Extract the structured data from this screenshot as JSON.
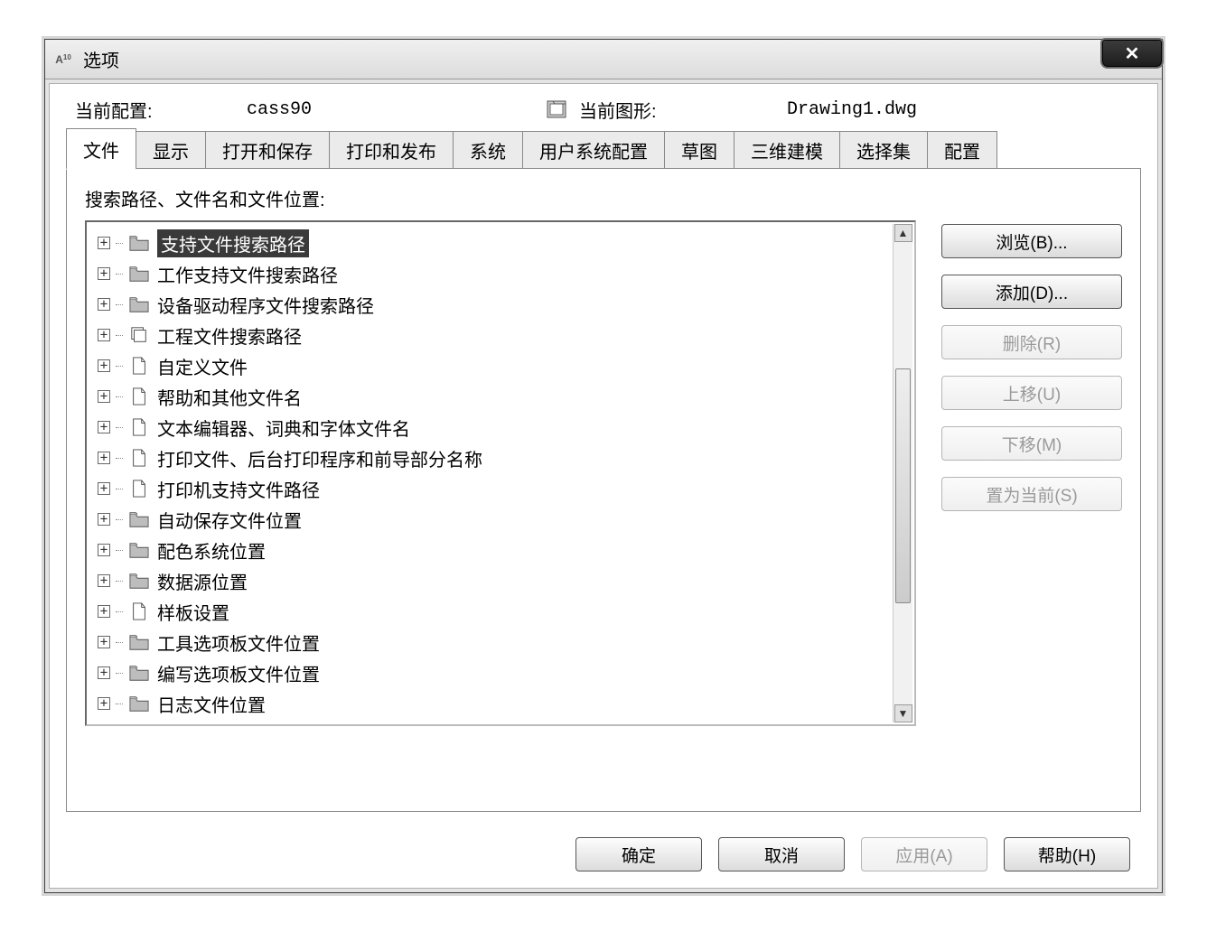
{
  "titlebar": {
    "title": "选项",
    "close_glyph": "✕"
  },
  "profile": {
    "current_profile_label": "当前配置:",
    "current_profile_value": "cass90",
    "current_drawing_label": "当前图形:",
    "current_drawing_value": "Drawing1.dwg"
  },
  "tabs": [
    {
      "label": "文件",
      "active": true
    },
    {
      "label": "显示"
    },
    {
      "label": "打开和保存"
    },
    {
      "label": "打印和发布"
    },
    {
      "label": "系统"
    },
    {
      "label": "用户系统配置"
    },
    {
      "label": "草图"
    },
    {
      "label": "三维建模"
    },
    {
      "label": "选择集"
    },
    {
      "label": "配置"
    }
  ],
  "section_label": "搜索路径、文件名和文件位置:",
  "tree": [
    {
      "label": "支持文件搜索路径",
      "icon": "folder",
      "selected": true
    },
    {
      "label": "工作支持文件搜索路径",
      "icon": "folder"
    },
    {
      "label": "设备驱动程序文件搜索路径",
      "icon": "folder"
    },
    {
      "label": "工程文件搜索路径",
      "icon": "stack"
    },
    {
      "label": "自定义文件",
      "icon": "file"
    },
    {
      "label": "帮助和其他文件名",
      "icon": "file"
    },
    {
      "label": "文本编辑器、词典和字体文件名",
      "icon": "file"
    },
    {
      "label": "打印文件、后台打印程序和前导部分名称",
      "icon": "file"
    },
    {
      "label": "打印机支持文件路径",
      "icon": "file"
    },
    {
      "label": "自动保存文件位置",
      "icon": "folder"
    },
    {
      "label": "配色系统位置",
      "icon": "folder"
    },
    {
      "label": "数据源位置",
      "icon": "folder"
    },
    {
      "label": "样板设置",
      "icon": "file"
    },
    {
      "label": "工具选项板文件位置",
      "icon": "folder"
    },
    {
      "label": "编写选项板文件位置",
      "icon": "folder"
    },
    {
      "label": "日志文件位置",
      "icon": "folder"
    }
  ],
  "side_buttons": [
    {
      "label": "浏览(B)...",
      "enabled": true,
      "name": "browse-button"
    },
    {
      "label": "添加(D)...",
      "enabled": true,
      "name": "add-button"
    },
    {
      "label": "删除(R)",
      "enabled": false,
      "name": "remove-button"
    },
    {
      "label": "上移(U)",
      "enabled": false,
      "name": "move-up-button"
    },
    {
      "label": "下移(M)",
      "enabled": false,
      "name": "move-down-button"
    },
    {
      "label": "置为当前(S)",
      "enabled": false,
      "name": "set-current-button"
    }
  ],
  "cmd_buttons": [
    {
      "label": "确定",
      "enabled": true,
      "name": "ok-button"
    },
    {
      "label": "取消",
      "enabled": true,
      "name": "cancel-button"
    },
    {
      "label": "应用(A)",
      "enabled": false,
      "name": "apply-button"
    },
    {
      "label": "帮助(H)",
      "enabled": true,
      "name": "help-button"
    }
  ]
}
